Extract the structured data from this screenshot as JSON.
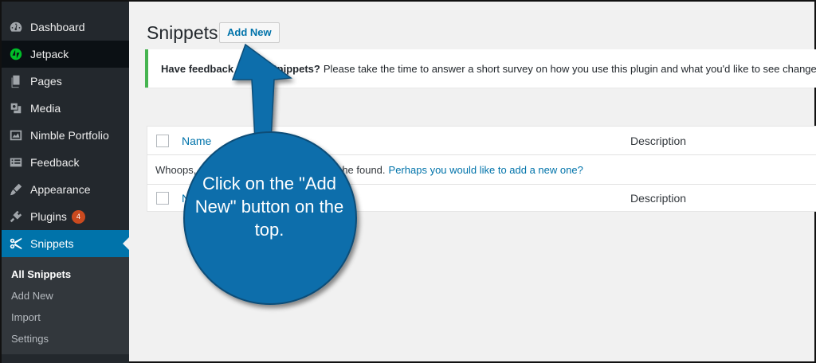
{
  "sidebar": {
    "items": [
      {
        "label": "Dashboard",
        "icon": "dashboard-icon"
      },
      {
        "label": "Jetpack",
        "icon": "jetpack-icon"
      },
      {
        "label": "Pages",
        "icon": "pages-icon"
      },
      {
        "label": "Media",
        "icon": "media-icon"
      },
      {
        "label": "Nimble Portfolio",
        "icon": "portfolio-icon"
      },
      {
        "label": "Feedback",
        "icon": "feedback-icon"
      },
      {
        "label": "Appearance",
        "icon": "appearance-icon"
      },
      {
        "label": "Plugins",
        "icon": "plugins-icon",
        "badge": "4"
      },
      {
        "label": "Snippets",
        "icon": "snippets-icon"
      }
    ],
    "submenu": [
      "All Snippets",
      "Add New",
      "Import",
      "Settings"
    ]
  },
  "header": {
    "title": "Snippets",
    "add_new_label": "Add New"
  },
  "notice": {
    "bold": "Have feedback",
    "bold2": "Snippets?",
    "text": "Please take the time to answer a short survey on how you use this plugin and what you'd like to see changed"
  },
  "table": {
    "col_name": "Name",
    "col_description": "Description",
    "empty_text": "Whoops,",
    "empty_text_tail": "he found.",
    "empty_link": "Perhaps you would like to add a new one?",
    "foot_name_partial": "N"
  },
  "callout": {
    "text": "Click on the \"Add New\" button on the top.",
    "color": "#0e6eab"
  }
}
